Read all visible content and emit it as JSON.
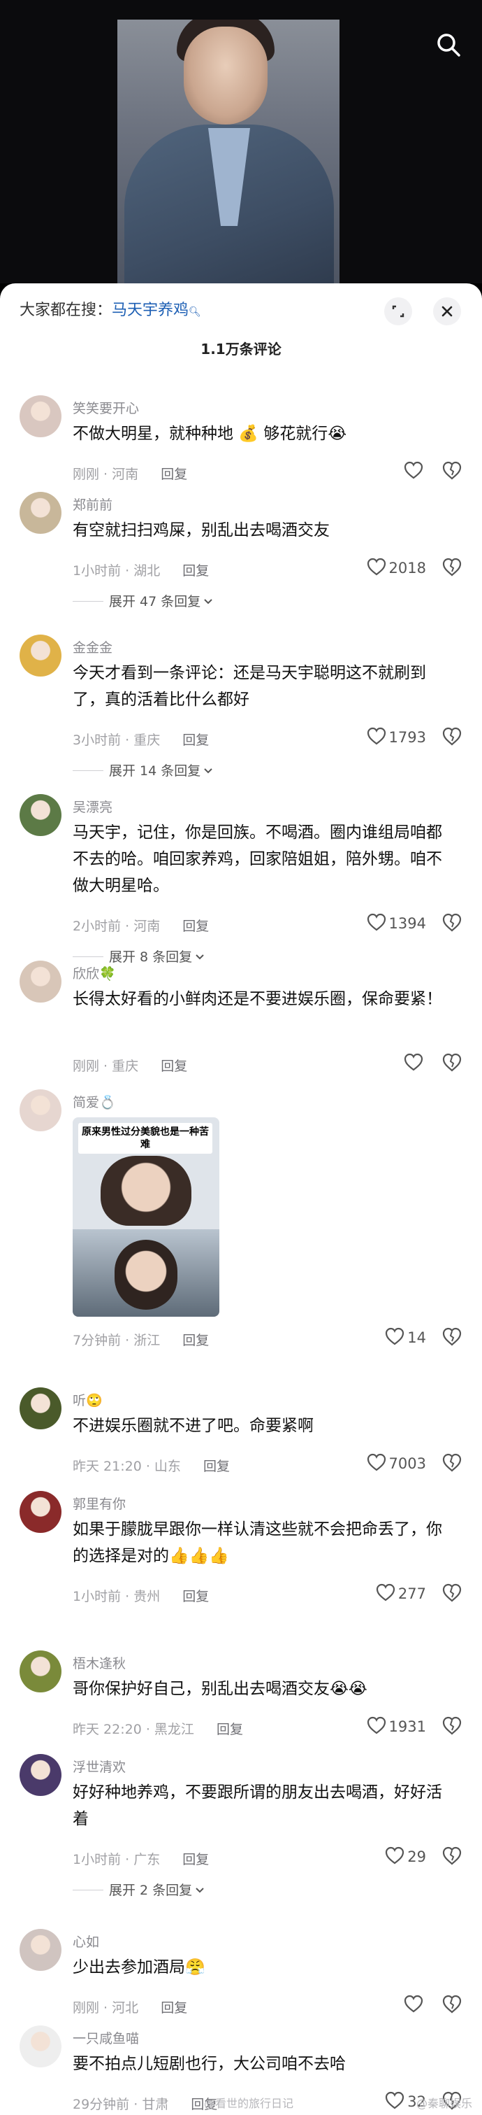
{
  "header": {
    "everyone_searching_label": "大家都在搜：",
    "search_keyword": "马天宇养鸡",
    "comment_count": "1.1万条评论"
  },
  "comments": [
    {
      "user": "笑笑要开心",
      "text": "不做大明星，就种种地 💰 够花就行😭",
      "time": "刚刚",
      "location": "河南",
      "reply": "回复",
      "likes": "",
      "avatar_color": "#d9c7c0"
    },
    {
      "user": "郑前前",
      "text": "有空就扫扫鸡屎，别乱出去喝酒交友",
      "time": "1小时前",
      "location": "湖北",
      "reply": "回复",
      "likes": "2018",
      "more_replies": "展开 47 条回复",
      "avatar_color": "#c8b79a"
    },
    {
      "user": "金金金",
      "text": "今天才看到一条评论：还是马天宇聪明这不就刷到了，真的活着比什么都好",
      "time": "3小时前",
      "location": "重庆",
      "reply": "回复",
      "likes": "1793",
      "more_replies": "展开 14 条回复",
      "avatar_color": "#e0b248"
    },
    {
      "user": "吴漂亮",
      "text": "马天宇，记住，你是回族。不喝酒。圈内谁组局咱都不去的哈。咱回家养鸡，回家陪姐姐，陪外甥。咱不做大明星哈。",
      "time": "2小时前",
      "location": "河南",
      "reply": "回复",
      "likes": "1394",
      "more_replies": "展开 8 条回复",
      "avatar_color": "#5c7a46"
    },
    {
      "user": "欣欣🍀",
      "text": "长得太好看的小鲜肉还是不要进娱乐圈，保命要紧！",
      "time": "刚刚",
      "location": "重庆",
      "reply": "回复",
      "likes": "",
      "avatar_color": "#d8c6b8"
    },
    {
      "user": "简爱💍",
      "text": "",
      "image_caption": "原来男性过分美貌也是一种苦难",
      "time": "7分钟前",
      "location": "浙江",
      "reply": "回复",
      "likes": "14",
      "avatar_color": "#e6d6d0"
    },
    {
      "user": "听🙄",
      "text": "不进娱乐圈就不进了吧。命要紧啊",
      "time": "昨天 21:20",
      "location": "山东",
      "reply": "回复",
      "likes": "7003",
      "avatar_color": "#4a5a2a"
    },
    {
      "user": "郭里有你",
      "text": "如果于朦胧早跟你一样认清这些就不会把命丢了，你的选择是对的👍👍👍",
      "time": "1小时前",
      "location": "贵州",
      "reply": "回复",
      "likes": "277",
      "avatar_color": "#8a2a2a"
    },
    {
      "user": "梧木逢秋",
      "text": "哥你保护好自己，别乱出去喝酒交友😭😭",
      "time": "昨天 22:20",
      "location": "黑龙江",
      "reply": "回复",
      "likes": "1931",
      "avatar_color": "#7a8a3a"
    },
    {
      "user": "浮世清欢",
      "text": "好好种地养鸡，不要跟所谓的朋友出去喝酒，好好活着",
      "time": "1小时前",
      "location": "广东",
      "reply": "回复",
      "likes": "29",
      "more_replies": "展开 2 条回复",
      "avatar_color": "#4a3a6a"
    },
    {
      "user": "心如",
      "text": "少出去参加酒局😤",
      "time": "刚刚",
      "location": "河北",
      "reply": "回复",
      "likes": "",
      "avatar_color": "#d0c4c0"
    },
    {
      "user": "一只咸鱼喵",
      "text": "要不拍点儿短剧也行，大公司咱不去哈",
      "time": "29分钟前",
      "location": "甘肃",
      "reply": "回复",
      "likes": "32",
      "avatar_color": "#eeeeee"
    }
  ],
  "watermarks": [
    "@看世的旅行日记",
    "@秦聊娱乐"
  ],
  "colors": {
    "keyword": "#1d5fb4",
    "panel_bg": "#ffffff",
    "video_bg": "#0b0b0d"
  },
  "icons": [
    "search-icon",
    "expand-icon",
    "close-icon",
    "heart-icon",
    "dislike-icon",
    "chevron-down-icon"
  ]
}
